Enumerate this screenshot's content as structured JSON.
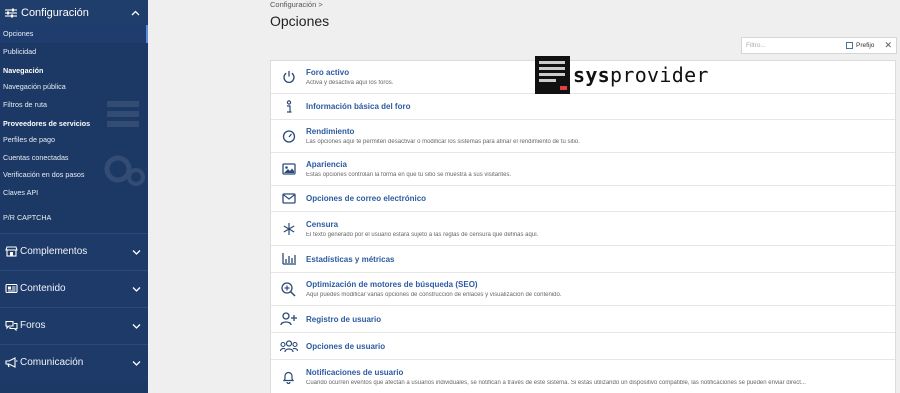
{
  "sidebar": {
    "header": {
      "label": "Configuración",
      "icon": "sliders-icon"
    },
    "items": [
      {
        "label": "Opciones",
        "active": true
      },
      {
        "label": "Publicidad"
      }
    ],
    "navegacion": {
      "heading": "Navegación",
      "items": [
        {
          "label": "Navegación pública"
        },
        {
          "label": "Filtros de ruta"
        }
      ]
    },
    "proveedores": {
      "heading": "Proveedores de servicios",
      "items": [
        {
          "label": "Perfiles de pago"
        },
        {
          "label": "Cuentas conectadas"
        },
        {
          "label": "Verificación en dos pasos"
        },
        {
          "label": "Claves API"
        },
        {
          "label": "P/R CAPTCHA"
        }
      ]
    },
    "groups": [
      {
        "label": "Complementos",
        "icon": "store-icon"
      },
      {
        "label": "Contenido",
        "icon": "newspaper-icon"
      },
      {
        "label": "Foros",
        "icon": "comments-icon"
      },
      {
        "label": "Comunicación",
        "icon": "bullhorn-icon"
      }
    ]
  },
  "breadcrumb": "Configuración  >",
  "page_title": "Opciones",
  "filter": {
    "placeholder": "Filtro...",
    "prefix_label": "Prefijo",
    "close": "✕"
  },
  "brand": {
    "part1": "sys",
    "part2": "provider"
  },
  "options": [
    {
      "title": "Foro activo",
      "desc": "Activa y desactiva aquí los foros.",
      "icon": "power-icon"
    },
    {
      "title": "Información básica del foro",
      "desc": "",
      "icon": "info-icon"
    },
    {
      "title": "Rendimiento",
      "desc": "Las opciones aquí te permiten desactivar o modificar los sistemas para afinar el rendimiento de tu sitio.",
      "icon": "gauge-icon"
    },
    {
      "title": "Apariencia",
      "desc": "Estas opciones controlan la forma en que tu sitio se muestra a sus visitantes.",
      "icon": "image-icon"
    },
    {
      "title": "Opciones de correo electrónico",
      "desc": "",
      "icon": "envelope-icon"
    },
    {
      "title": "Censura",
      "desc": "El texto generado por el usuario estará sujeto a las reglas de censura que definas aquí.",
      "icon": "asterisk-icon"
    },
    {
      "title": "Estadísticas y métricas",
      "desc": "",
      "icon": "chart-bars-icon"
    },
    {
      "title": "Optimización de motores de búsqueda (SEO)",
      "desc": "Aquí puedes modificar varias opciones de construcción de enlaces y visualización de contenido.",
      "icon": "search-plus-icon"
    },
    {
      "title": "Registro de usuario",
      "desc": "",
      "icon": "user-plus-icon"
    },
    {
      "title": "Opciones de usuario",
      "desc": "",
      "icon": "users-icon"
    },
    {
      "title": "Notificaciones de usuario",
      "desc": "Cuando ocurren eventos que afectan a usuarios individuales, se notifican a través de este sistema. Si estás utilizando un dispositivo compatible, las notificaciones se pueden enviar direct...",
      "icon": "bell-icon"
    }
  ]
}
